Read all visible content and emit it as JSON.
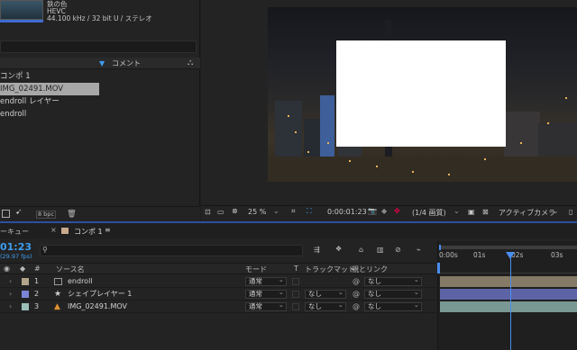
{
  "project": {
    "item_name": "鉄の色",
    "codec": "HEVC",
    "audio_info": "44.100 kHz / 32 bit U / ステレオ",
    "comment_header": "コメント",
    "items": [
      "コンポ 1",
      "IMG_02491.MOV",
      "endroll レイヤー",
      "endroll"
    ],
    "bpc": "8 bpc"
  },
  "viewer": {
    "zoom": "25 %",
    "timecode": "0:00:01:23",
    "quality": "(1/4 画質)",
    "camera": "アクティブカメラ"
  },
  "timeline": {
    "left_tab": "ーキュー",
    "comp_tab": "コンポ 1",
    "timecode": "01:23",
    "fps": "(29.97 fps)",
    "columns": {
      "hash": "#",
      "source": "ソース名",
      "mode": "モード",
      "t": "T",
      "track": "トラックマット",
      "parent": "親とリンク"
    },
    "layers": [
      {
        "num": "1",
        "name": "endroll",
        "mode": "通常",
        "track": "",
        "parent": "なし",
        "color": "#b4a58a",
        "bar": "#847a66"
      },
      {
        "num": "2",
        "name": "シェイプレイヤー 1",
        "mode": "通常",
        "track": "なし",
        "parent": "なし",
        "color": "#7b85d6",
        "bar": "#5d64a6"
      },
      {
        "num": "3",
        "name": "IMG_02491.MOV",
        "mode": "通常",
        "track": "なし",
        "parent": "なし",
        "color": "#9bbfb8",
        "bar": "#7a9893"
      }
    ],
    "ruler": [
      "0:00s",
      "01s",
      "02s",
      "03s"
    ]
  },
  "colors": {
    "accent": "#3e9df0",
    "playhead": "#4a8df0"
  }
}
